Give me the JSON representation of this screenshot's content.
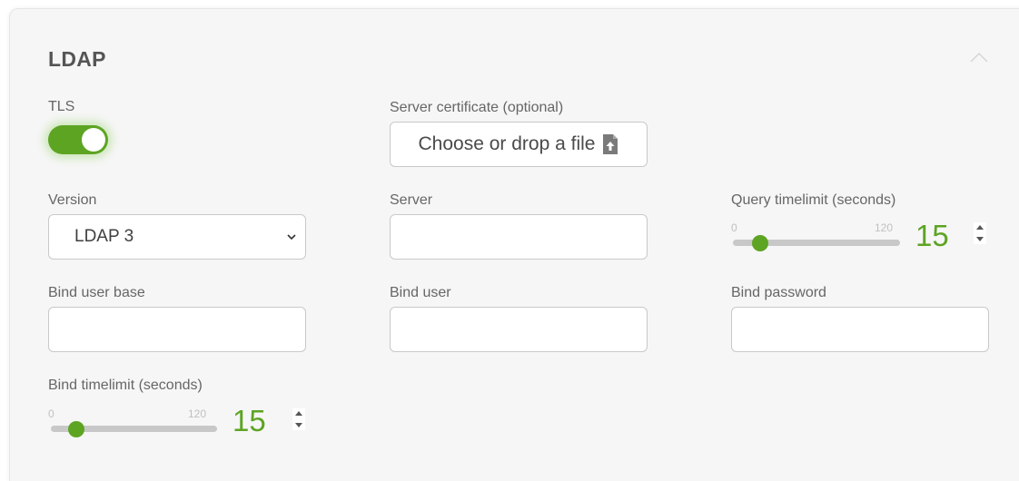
{
  "section": {
    "title": "LDAP"
  },
  "tls": {
    "label": "TLS",
    "enabled": true
  },
  "certificate": {
    "label": "Server certificate (optional)",
    "button_label": "Choose or drop a file"
  },
  "version": {
    "label": "Version",
    "selected": "LDAP 3"
  },
  "server": {
    "label": "Server",
    "value": ""
  },
  "query_timelimit": {
    "label": "Query timelimit (seconds)",
    "min": "0",
    "max": "120",
    "value": "15"
  },
  "bind_user_base": {
    "label": "Bind user base",
    "value": ""
  },
  "bind_user": {
    "label": "Bind user",
    "value": ""
  },
  "bind_password": {
    "label": "Bind password",
    "value": ""
  },
  "bind_timelimit": {
    "label": "Bind timelimit (seconds)",
    "min": "0",
    "max": "120",
    "value": "15"
  },
  "colors": {
    "accent": "#5da423",
    "background": "#f6f6f6",
    "border": "#c9c9c9"
  },
  "icons": [
    "chevron-up-icon",
    "file-upload-icon",
    "chevron-down-icon",
    "spinner-up-icon",
    "spinner-down-icon"
  ]
}
